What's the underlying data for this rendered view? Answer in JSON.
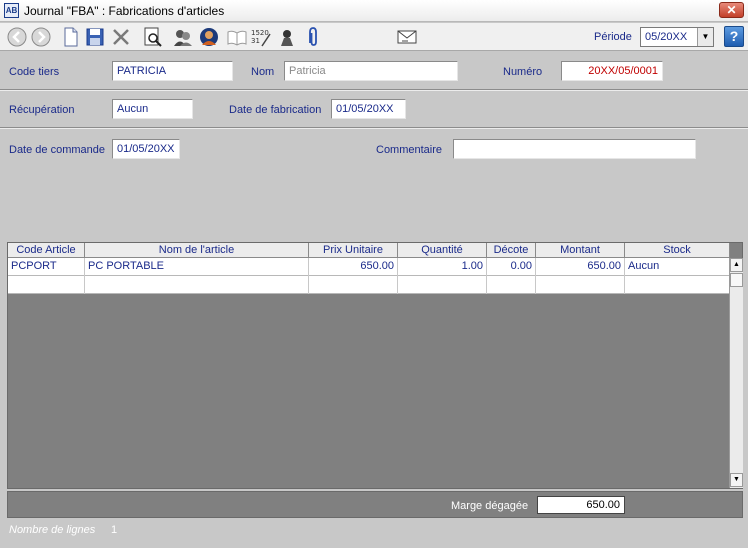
{
  "window": {
    "title": "Journal \"FBA\" : Fabrications d'articles",
    "app_icon": "AB",
    "close_glyph": "✕"
  },
  "toolbar": {
    "icons": [
      "back-icon",
      "forward-icon",
      "new-document-icon",
      "save-icon",
      "delete-icon",
      "preview-icon",
      "users-icon",
      "contact-icon",
      "book-icon",
      "numbering-icon",
      "stamp-icon",
      "attachment-icon",
      "envelope-icon"
    ],
    "periode_label": "Période",
    "periode_value": "05/20XX",
    "help_glyph": "?"
  },
  "form": {
    "code_tiers_label": "Code tiers",
    "code_tiers_value": "PATRICIA",
    "nom_label": "Nom",
    "nom_value": "Patricia",
    "numero_label": "Numéro",
    "numero_value": "20XX/05/0001",
    "recuperation_label": "Récupération",
    "recuperation_value": "Aucun",
    "date_fabrication_label": "Date de fabrication",
    "date_fabrication_value": "01/05/20XX",
    "date_commande_label": "Date de commande",
    "date_commande_value": "01/05/20XX",
    "commentaire_label": "Commentaire",
    "commentaire_value": ""
  },
  "grid": {
    "columns": [
      "Code Article",
      "Nom de l'article",
      "Prix Unitaire",
      "Quantité",
      "Décote",
      "Montant",
      "Stock"
    ],
    "rows": [
      [
        "PCPORT",
        "PC PORTABLE",
        "650.00",
        "1.00",
        "0.00",
        "650.00",
        "Aucun"
      ],
      [
        "",
        "",
        "",
        "",
        "",
        "",
        ""
      ]
    ]
  },
  "footer": {
    "marge_label": "Marge dégagée",
    "marge_value": "650.00"
  },
  "status": {
    "label": "Nombre de lignes",
    "count": "1"
  },
  "colors": {
    "label_text": "#1a2a8a",
    "numero_text": "#c00000",
    "grid_bg": "#808080",
    "window_bg": "#c8c8c8"
  }
}
